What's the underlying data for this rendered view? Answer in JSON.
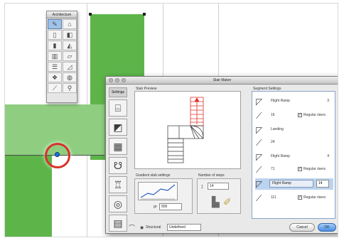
{
  "palette": {
    "title": "Architecture",
    "tools": [
      "pencil",
      "stair-pair",
      "door",
      "window",
      "wall",
      "roof",
      "column",
      "slab",
      "stair",
      "ramp",
      "object",
      "mesh",
      "eyedropper",
      "magic-wand"
    ]
  },
  "dialog": {
    "title": "Stair Maker",
    "tabs": {
      "selected_label": "Settings"
    },
    "preview": {
      "label": "Stair Preview"
    },
    "segments": {
      "label": "Segment Settings",
      "rows": [
        {
          "icon": "flight-icon",
          "label": "Flight Ramp",
          "value": "3"
        },
        {
          "icon": "riser-icon",
          "label": "16",
          "check_label": "Regular risers"
        },
        {
          "icon": "landing-icon",
          "label": "Landing"
        },
        {
          "icon": "riser-icon",
          "label": "24"
        },
        {
          "icon": "flight-icon",
          "label": "Flight Ramp",
          "value": "4"
        },
        {
          "icon": "riser-icon",
          "label": "71",
          "check_label": "Regular risers"
        },
        {
          "icon": "flight-icon",
          "label": "Flight Ramp",
          "value": "14",
          "selected": true
        },
        {
          "icon": "riser-icon",
          "label": "111",
          "check_label": "Regular risers"
        }
      ]
    },
    "gradient": {
      "label": "Gradient slab settings",
      "field_prefix": "gr",
      "field_value": "500"
    },
    "risers": {
      "label": "Number of steps",
      "value": "14"
    },
    "footer": {
      "structural_label": "Structural",
      "structural_value": "Undefined",
      "cancel_label": "Cancel",
      "ok_label": "OK"
    }
  },
  "colors": {
    "plan_green": "#5db54a",
    "marker_red": "#d8322a",
    "preview_red": "#e0302a",
    "selection_blue": "#bcd3ef"
  }
}
